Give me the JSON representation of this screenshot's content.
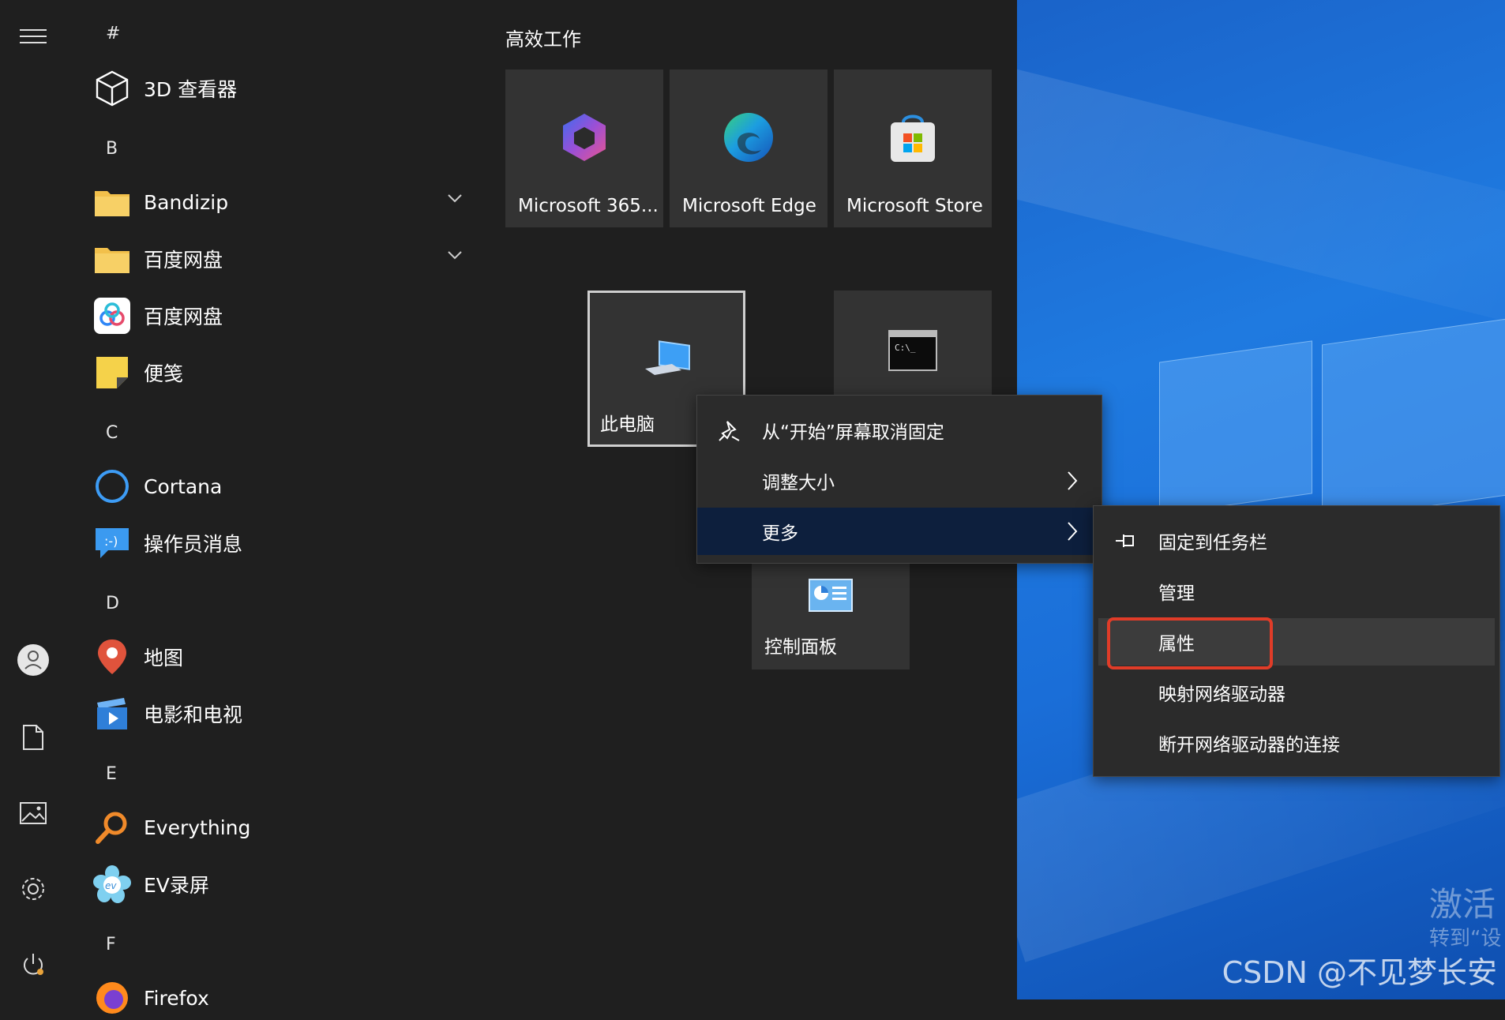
{
  "rail": {
    "icons": [
      "hamburger-menu-icon",
      "user-avatar-icon",
      "document-icon",
      "pictures-icon",
      "settings-gear-icon",
      "power-icon"
    ]
  },
  "app_list": {
    "sections": [
      {
        "letter": "#",
        "items": [
          {
            "label": "3D 查看器",
            "icon": "cube-icon",
            "expandable": false
          }
        ]
      },
      {
        "letter": "B",
        "items": [
          {
            "label": "Bandizip",
            "icon": "folder-icon",
            "expandable": true
          },
          {
            "label": "百度网盘",
            "icon": "folder-icon",
            "expandable": true
          },
          {
            "label": "百度网盘",
            "icon": "baidu-netdisk-icon",
            "expandable": false
          },
          {
            "label": "便笺",
            "icon": "sticky-notes-icon",
            "expandable": false
          }
        ]
      },
      {
        "letter": "C",
        "items": [
          {
            "label": "Cortana",
            "icon": "cortana-circle-icon",
            "expandable": false
          },
          {
            "label": "操作员消息",
            "icon": "operator-message-icon",
            "expandable": false
          }
        ]
      },
      {
        "letter": "D",
        "items": [
          {
            "label": "地图",
            "icon": "map-pin-icon",
            "expandable": false
          },
          {
            "label": "电影和电视",
            "icon": "movies-tv-icon",
            "expandable": false
          }
        ]
      },
      {
        "letter": "E",
        "items": [
          {
            "label": "Everything",
            "icon": "everything-search-icon",
            "expandable": false
          },
          {
            "label": "EV录屏",
            "icon": "ev-recorder-icon",
            "expandable": false
          }
        ]
      },
      {
        "letter": "F",
        "items": [
          {
            "label": "Firefox",
            "icon": "firefox-icon",
            "expandable": false
          }
        ]
      }
    ]
  },
  "tiles": {
    "group_title": "高效工作",
    "items": [
      {
        "label": "Microsoft 365...",
        "icon": "microsoft-365-icon"
      },
      {
        "label": "Microsoft Edge",
        "icon": "edge-icon"
      },
      {
        "label": "Microsoft Store",
        "icon": "store-bag-icon"
      },
      {
        "label": "此电脑",
        "icon": "this-pc-icon",
        "selected": true
      },
      {
        "label": "",
        "icon": "command-prompt-icon"
      },
      {
        "label": "控制面板",
        "icon": "control-panel-icon"
      }
    ],
    "cmd_text": "C:\\_"
  },
  "context_menu": {
    "items": [
      {
        "label": "从“开始”屏幕取消固定",
        "icon": "unpin-icon",
        "submenu": false
      },
      {
        "label": "调整大小",
        "icon": "",
        "submenu": true
      },
      {
        "label": "更多",
        "icon": "",
        "submenu": true,
        "active": true
      }
    ]
  },
  "submenu": {
    "items": [
      {
        "label": "固定到任务栏",
        "icon": "pin-taskbar-icon"
      },
      {
        "label": "管理",
        "icon": ""
      },
      {
        "label": "属性",
        "icon": "",
        "highlighted": true
      },
      {
        "label": "映射网络驱动器",
        "icon": ""
      },
      {
        "label": "断开网络驱动器的连接",
        "icon": ""
      }
    ]
  },
  "desktop": {
    "activate_text": "激活 W",
    "goto_text": "转到“设",
    "csdn_watermark": "CSDN @不见梦长安"
  },
  "colors": {
    "start_bg": "#1f1f1f",
    "tile_bg": "#333333",
    "menu_bg": "#2b2b2b",
    "menu_active": "#0d1f3d",
    "highlight": "#e03c28",
    "desktop": "#1f7ae0"
  }
}
